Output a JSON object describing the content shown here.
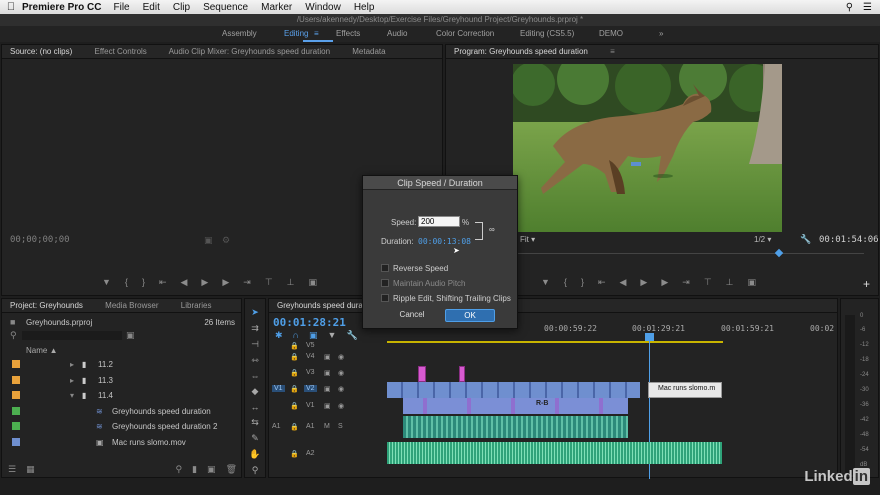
{
  "menubar": {
    "app": "Premiere Pro CC",
    "items": [
      "File",
      "Edit",
      "Clip",
      "Sequence",
      "Marker",
      "Window",
      "Help"
    ]
  },
  "titlebar": {
    "path": "/Users/akennedy/Desktop/Exercise Files/Greyhound Project/Greyhounds.prproj *"
  },
  "workspaces": [
    "Assembly",
    "Editing",
    "Effects",
    "Audio",
    "Color Correction",
    "Editing (CS5.5)",
    "DEMO"
  ],
  "workspace_overflow": "»",
  "source": {
    "tabs": [
      "Source: (no clips)",
      "Effect Controls",
      "Audio Clip Mixer: Greyhounds speed duration",
      "Metadata"
    ],
    "timecode": "00;00;00;00"
  },
  "program": {
    "tab": "Program: Greyhounds speed duration",
    "fit": "Fit",
    "ratio": "1/2",
    "timecode": "00:01:54:06"
  },
  "project": {
    "tabs": [
      "Project: Greyhounds",
      "Media Browser",
      "Libraries"
    ],
    "file": "Greyhounds.prproj",
    "count": "26 Items",
    "name_header": "Name",
    "rows": [
      {
        "label": "11.2",
        "color": "#e9a23b"
      },
      {
        "label": "11.3",
        "color": "#e9a23b"
      },
      {
        "label": "11.4",
        "color": "#e9a23b"
      },
      {
        "label": "Greyhounds speed duration",
        "color": "#4caf50"
      },
      {
        "label": "Greyhounds speed duration 2",
        "color": "#4caf50"
      },
      {
        "label": "Mac runs slomo.mov",
        "color": "#6f8fcf"
      }
    ]
  },
  "timeline": {
    "tab": "Greyhounds speed duration",
    "timecode": "00:01:28:21",
    "ruler": [
      "00:00:59:22",
      "00:01:29:21",
      "00:01:59:21",
      "00:02"
    ],
    "tracks": [
      "V5",
      "V4",
      "V3",
      "V2",
      "V1",
      "A1",
      "A2"
    ],
    "v1_src": "V1",
    "a1_src": "A1",
    "clip_label": "Mac runs slomo.m",
    "fx_label": "R-B"
  },
  "dialog": {
    "title": "Clip Speed / Duration",
    "speed_label": "Speed:",
    "speed_value": "200",
    "percent": "%",
    "duration_label": "Duration:",
    "duration_value": "00:00:13:08",
    "reverse": "Reverse Speed",
    "maintain": "Maintain Audio Pitch",
    "ripple": "Ripple Edit, Shifting Trailing Clips",
    "cancel": "Cancel",
    "ok": "OK"
  },
  "meter": [
    "0",
    "-6",
    "-12",
    "-18",
    "-24",
    "-30",
    "-36",
    "-42",
    "-48",
    "-54",
    "dB"
  ],
  "watermark": {
    "text": "Linked",
    "badge": "in"
  },
  "colors": {
    "accent": "#4f9fe8",
    "video_clip": "#6f8fcf",
    "audio_clip": "#2fa37a",
    "label_orange": "#e9a23b",
    "label_green": "#4caf50",
    "label_pink": "#d75ad0"
  }
}
